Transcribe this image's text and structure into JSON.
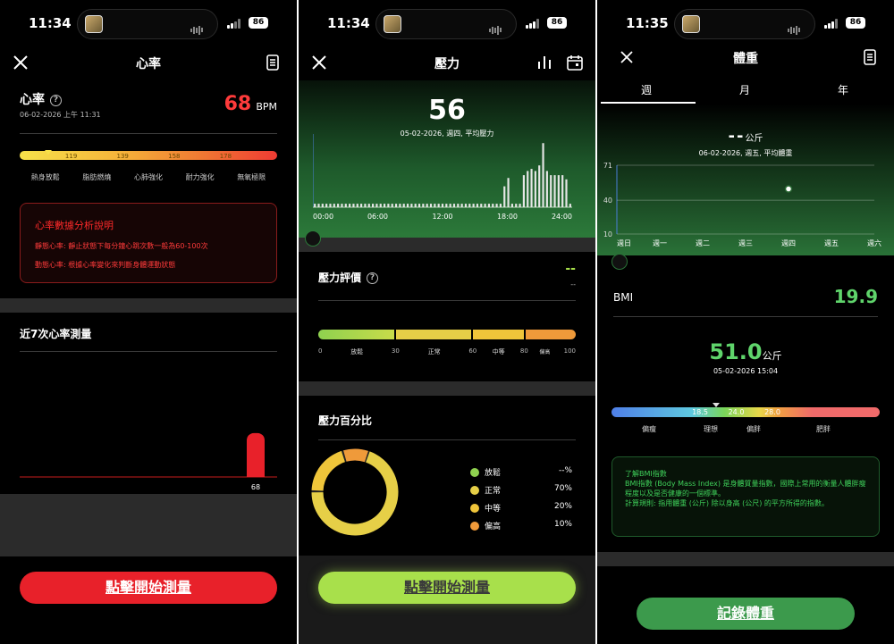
{
  "heart": {
    "time": "11:34",
    "battery": "86",
    "title": "心率",
    "label": "心率",
    "date": "06-02-2026 上午 11:31",
    "value": "68",
    "unit": "BPM",
    "scale_ticks": [
      "119",
      "139",
      "158",
      "178"
    ],
    "zones": [
      "熱身放鬆",
      "脂肪燃燒",
      "心肺強化",
      "耐力強化",
      "無氧極限"
    ],
    "marker_fraction": 0.11,
    "analysis_title": "心率數據分析說明",
    "analysis_line1": "靜態心率: 靜止狀態下每分鐘心跳次數一般為60-100次",
    "analysis_line2": "動態心率: 根據心率變化來判斷身體運動狀態",
    "recent_title": "近7次心率測量",
    "recent_values": [
      68
    ],
    "recent_labels": [
      "68"
    ],
    "cta": "點擊開始測量",
    "accent": "#e8212a"
  },
  "stress": {
    "time": "11:34",
    "battery": "86",
    "title": "壓力",
    "value": "56",
    "subtitle": "05-02-2026, 週四, 平均壓力",
    "x_ticks": [
      "00:00",
      "06:00",
      "12:00",
      "18:00",
      "24:00"
    ],
    "bars": [
      5,
      5,
      5,
      5,
      5,
      5,
      5,
      5,
      5,
      5,
      5,
      5,
      5,
      5,
      5,
      5,
      5,
      5,
      5,
      5,
      5,
      5,
      5,
      5,
      5,
      5,
      5,
      5,
      5,
      5,
      5,
      5,
      5,
      5,
      5,
      5,
      5,
      5,
      5,
      5,
      5,
      5,
      5,
      5,
      5,
      5,
      5,
      5,
      5,
      30,
      42,
      5,
      5,
      5,
      46,
      52,
      55,
      52,
      60,
      92,
      52,
      46,
      46,
      46,
      46,
      40,
      5
    ],
    "rating_title": "壓力評價",
    "rating_value": "--",
    "rating_sub": "--",
    "scale_numbers": [
      "0",
      "30",
      "60",
      "80",
      "100"
    ],
    "scale_words": [
      "放鬆",
      "正常",
      "中等",
      "偏高"
    ],
    "percent_title": "壓力百分比",
    "legend": [
      {
        "name": "放鬆",
        "value": "--%",
        "color": "#8fd14f"
      },
      {
        "name": "正常",
        "value": "70%",
        "color": "#e6cf47"
      },
      {
        "name": "中等",
        "value": "20%",
        "color": "#efc53a"
      },
      {
        "name": "偏高",
        "value": "10%",
        "color": "#ef9a3a"
      }
    ],
    "donut_fractions": [
      0,
      0.7,
      0.2,
      0.1
    ],
    "cta": "點擊開始測量",
    "accent": "#a8e04b"
  },
  "weight": {
    "time": "11:35",
    "battery": "86",
    "title": "體重",
    "tabs": [
      "週",
      "月",
      "年"
    ],
    "chart_value": "--",
    "chart_unit": "公斤",
    "chart_subtitle": "06-02-2026, 週五, 平均體重",
    "y_ticks": [
      "71",
      "40",
      "10"
    ],
    "x_ticks": [
      "週日",
      "週一",
      "週二",
      "週三",
      "週四",
      "週五",
      "週六"
    ],
    "point_day_index": 4,
    "point_value": 50,
    "bmi_label": "BMI",
    "bmi_value": "19.9",
    "weight_value": "51.0",
    "weight_unit": "公斤",
    "weight_date": "05-02-2026 15:04",
    "bmi_ticks": [
      "18.5",
      "24.0",
      "28.0"
    ],
    "bmi_zones": [
      "偏瘦",
      "理想",
      "偏胖",
      "肥胖"
    ],
    "bmi_marker_fraction": 0.39,
    "info_title": "了解BMI指數",
    "info_line1": "BMI指數 (Body Mass Index) 是身體質量指數，國際上常用的衡量人體胖瘦程度以及是否健康的一個標準。",
    "info_line2": "計算規則: 指用體重 (公斤) 除以身高 (公尺) 的平方所得的指數。",
    "cta": "記錄體重",
    "accent": "#3c9a4c"
  }
}
